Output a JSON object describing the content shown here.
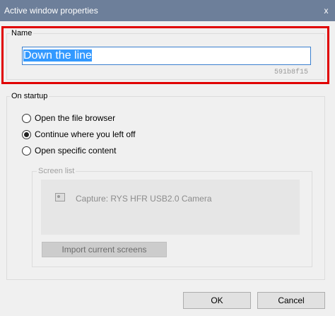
{
  "window": {
    "title": "Active window properties",
    "close_label": "x"
  },
  "name_group": {
    "legend": "Name",
    "value": "Down the line",
    "id_text": "591b8f15"
  },
  "startup_group": {
    "legend": "On startup",
    "options": [
      {
        "label": "Open the file browser",
        "selected": false
      },
      {
        "label": "Continue where you left off",
        "selected": true
      },
      {
        "label": "Open specific content",
        "selected": false
      }
    ]
  },
  "screen_list": {
    "legend": "Screen list",
    "items": [
      {
        "label": "Capture: RYS HFR USB2.0 Camera",
        "icon": "camera-icon"
      }
    ],
    "import_label": "Import current screens"
  },
  "buttons": {
    "ok": "OK",
    "cancel": "Cancel"
  },
  "colors": {
    "titlebar": "#6d7f9a",
    "highlight": "#e00000",
    "selection": "#3399ff"
  }
}
